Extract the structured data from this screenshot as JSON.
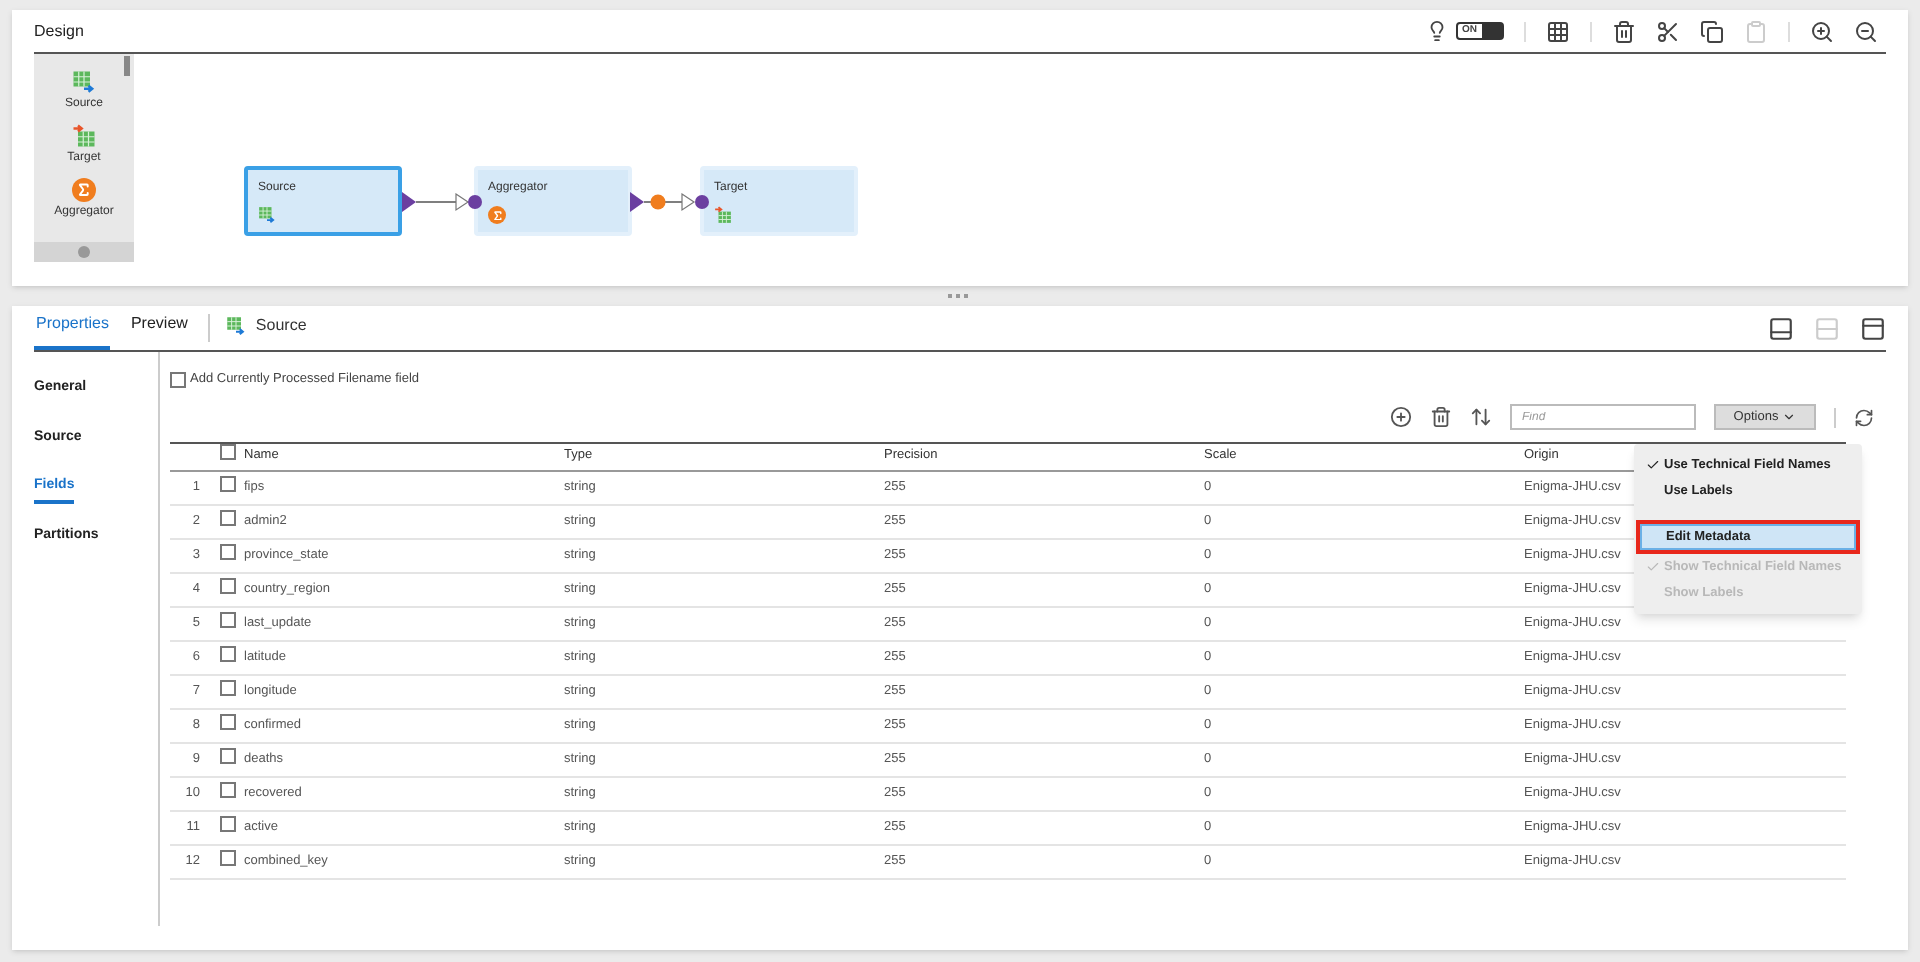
{
  "design": {
    "title": "Design",
    "toggle": {
      "label": "ON",
      "on": true
    },
    "palette": [
      {
        "label": "Source",
        "kind": "source"
      },
      {
        "label": "Target",
        "kind": "target"
      },
      {
        "label": "Aggregator",
        "kind": "aggregator"
      }
    ],
    "nodes": [
      {
        "label": "Source",
        "kind": "source",
        "selected": true
      },
      {
        "label": "Aggregator",
        "kind": "aggregator",
        "selected": false
      },
      {
        "label": "Target",
        "kind": "target",
        "selected": false
      }
    ]
  },
  "properties": {
    "tabs": [
      {
        "label": "Properties",
        "selected": true
      },
      {
        "label": "Preview",
        "selected": false
      }
    ],
    "object": {
      "label": "Source",
      "kind": "source"
    },
    "nav": [
      {
        "label": "General",
        "selected": false
      },
      {
        "label": "Source",
        "selected": false
      },
      {
        "label": "Fields",
        "selected": true
      },
      {
        "label": "Partitions",
        "selected": false
      }
    ],
    "add_filename": {
      "label": "Add Currently Processed Filename field",
      "checked": false
    },
    "find": {
      "placeholder": "Find"
    },
    "options_button": "Options",
    "header_checked": false,
    "columns": [
      "Name",
      "Type",
      "Precision",
      "Scale",
      "Origin"
    ],
    "rows": [
      {
        "index": "1",
        "name": "fips",
        "type": "string",
        "precision": "255",
        "scale": "0",
        "origin": "Enigma-JHU.csv",
        "checked": false
      },
      {
        "index": "2",
        "name": "admin2",
        "type": "string",
        "precision": "255",
        "scale": "0",
        "origin": "Enigma-JHU.csv",
        "checked": false
      },
      {
        "index": "3",
        "name": "province_state",
        "type": "string",
        "precision": "255",
        "scale": "0",
        "origin": "Enigma-JHU.csv",
        "checked": false
      },
      {
        "index": "4",
        "name": "country_region",
        "type": "string",
        "precision": "255",
        "scale": "0",
        "origin": "Enigma-JHU.csv",
        "checked": false
      },
      {
        "index": "5",
        "name": "last_update",
        "type": "string",
        "precision": "255",
        "scale": "0",
        "origin": "Enigma-JHU.csv",
        "checked": false
      },
      {
        "index": "6",
        "name": "latitude",
        "type": "string",
        "precision": "255",
        "scale": "0",
        "origin": "Enigma-JHU.csv",
        "checked": false
      },
      {
        "index": "7",
        "name": "longitude",
        "type": "string",
        "precision": "255",
        "scale": "0",
        "origin": "Enigma-JHU.csv",
        "checked": false
      },
      {
        "index": "8",
        "name": "confirmed",
        "type": "string",
        "precision": "255",
        "scale": "0",
        "origin": "Enigma-JHU.csv",
        "checked": false
      },
      {
        "index": "9",
        "name": "deaths",
        "type": "string",
        "precision": "255",
        "scale": "0",
        "origin": "Enigma-JHU.csv",
        "checked": false
      },
      {
        "index": "10",
        "name": "recovered",
        "type": "string",
        "precision": "255",
        "scale": "0",
        "origin": "Enigma-JHU.csv",
        "checked": false
      },
      {
        "index": "11",
        "name": "active",
        "type": "string",
        "precision": "255",
        "scale": "0",
        "origin": "Enigma-JHU.csv",
        "checked": false
      },
      {
        "index": "12",
        "name": "combined_key",
        "type": "string",
        "precision": "255",
        "scale": "0",
        "origin": "Enigma-JHU.csv",
        "checked": false
      }
    ],
    "options_menu": [
      {
        "kind": "option",
        "label": "Use Technical Field Names",
        "checked": true,
        "disabled": false,
        "highlighted": false
      },
      {
        "kind": "option",
        "label": "Use Labels",
        "checked": false,
        "disabled": false,
        "highlighted": false
      },
      {
        "kind": "separator"
      },
      {
        "kind": "option",
        "label": "Edit Metadata",
        "checked": false,
        "disabled": false,
        "highlighted": true
      },
      {
        "kind": "option",
        "label": "Show Technical Field Names",
        "checked": true,
        "disabled": true,
        "highlighted": false
      },
      {
        "kind": "option",
        "label": "Show Labels",
        "checked": false,
        "disabled": true,
        "highlighted": false
      }
    ]
  }
}
